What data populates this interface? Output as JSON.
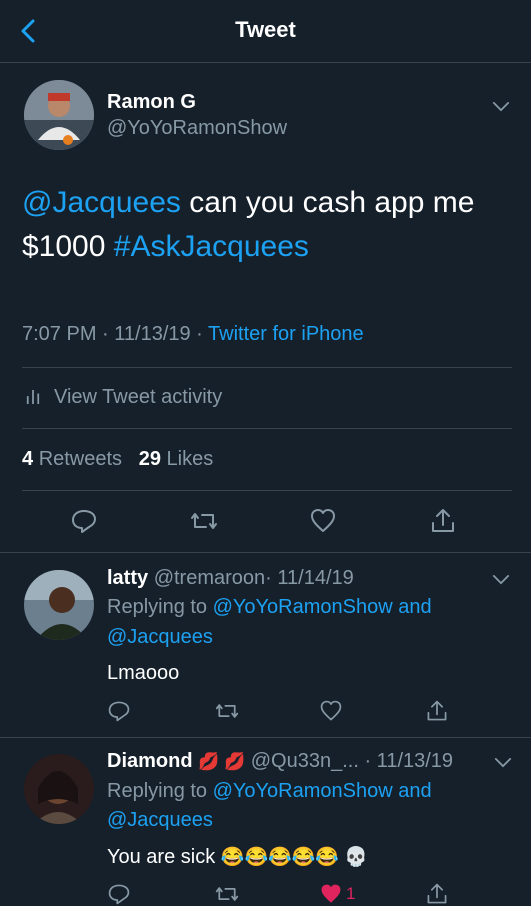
{
  "header": {
    "title": "Tweet"
  },
  "tweet": {
    "display_name": "Ramon G",
    "handle": "@YoYoRamonShow",
    "mention": "@Jacquees",
    "text_middle": " can you cash app me",
    "amount": "$1000",
    "hashtag": "#AskJacquees",
    "time": "7:07 PM · 11/13/19 · ",
    "source": "Twitter for iPhone",
    "activity_label": "View Tweet activity",
    "retweet_count": "4",
    "retweets_label": "Retweets",
    "like_count": "29",
    "likes_label": "Likes"
  },
  "replies": [
    {
      "display_name": "latty",
      "handle": "@tremaroon",
      "date": "· 11/14/19",
      "replying_prefix": "Replying to ",
      "replying_user1": "@YoYoRamonShow",
      "replying_and": " and",
      "replying_user2": "@Jacquees",
      "text": "Lmaooo"
    },
    {
      "display_name": "Diamond",
      "name_emoji": "💋 💋",
      "handle": "@Qu33n_...",
      "date": "· 11/13/19",
      "replying_prefix": "Replying to ",
      "replying_user1": "@YoYoRamonShow",
      "replying_and": " and",
      "replying_user2": "@Jacquees",
      "text": "You are sick",
      "emojis": "😂😂😂😂😂 💀",
      "like_count": "1"
    }
  ],
  "colors": {
    "background": "#15202b",
    "link": "#1da1f2",
    "muted": "#8899a6",
    "divider": "#38444d",
    "like": "#e0245e"
  }
}
